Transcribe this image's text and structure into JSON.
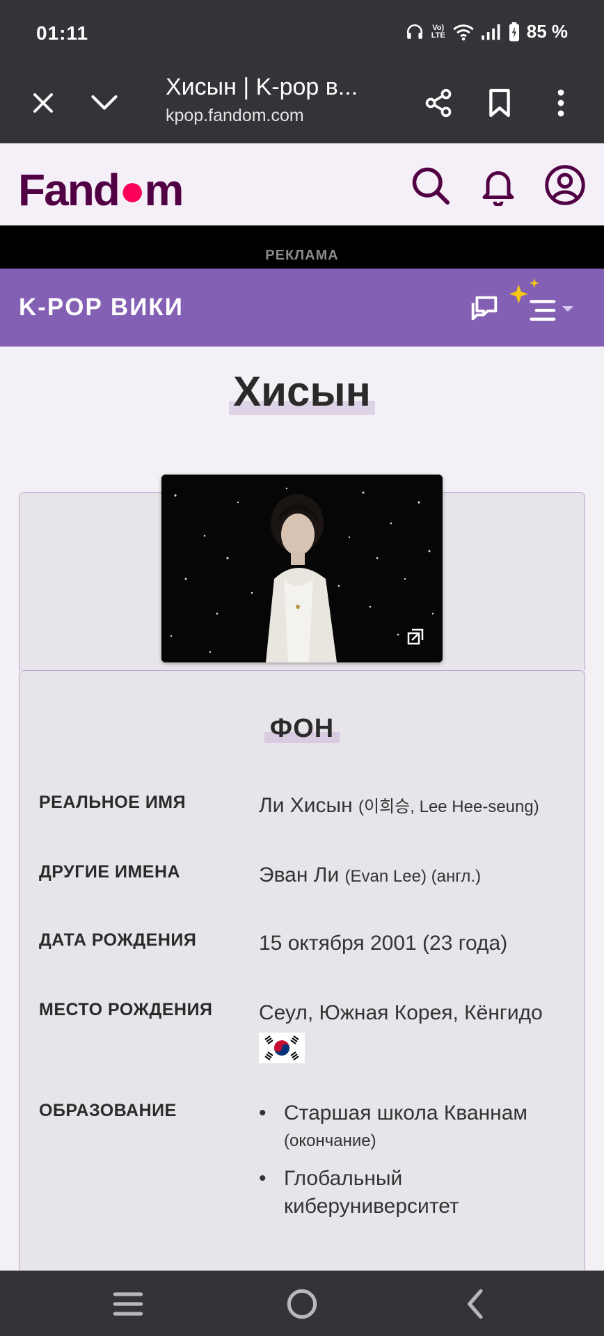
{
  "status": {
    "time": "01:11",
    "battery": "85 %",
    "volte": "Vo) LTE"
  },
  "browser": {
    "title": "Хисын | K-pop в...",
    "url": "kpop.fandom.com"
  },
  "fandom": {
    "logo_pre": "Fan",
    "logo_flame": "d",
    "logo_post": "m"
  },
  "ad": {
    "label": "РЕКЛАМА"
  },
  "wiki": {
    "name": "K-POP ВИКИ"
  },
  "article": {
    "title": "Хисын"
  },
  "infobox": {
    "section_title": "ФОН",
    "rows": [
      {
        "label": "РЕАЛЬНОЕ ИМЯ",
        "value": "Ли Хисын",
        "value_small": "(이희승, Lee Hee-seung)"
      },
      {
        "label": "ДРУГИЕ ИМЕНА",
        "value": "Эван Ли",
        "value_small": "(Evan Lee) (англ.)"
      },
      {
        "label": "ДАТА РОЖДЕНИЯ",
        "value": "15 октября 2001 (23 года)"
      },
      {
        "label": "МЕСТО РОЖДЕНИЯ",
        "value": "Сеул, Южная Корея, Кёнгидо"
      },
      {
        "label": "ОБРАЗОВАНИЕ",
        "items": [
          {
            "text": "Старшая школа Кваннам",
            "note": "(окончание)"
          },
          {
            "line1": "Глобальный",
            "line2": "киберуниверситет"
          }
        ]
      }
    ]
  },
  "colors": {
    "wiki_bar": "#8460b4",
    "fandom_brand": "#520044",
    "flame": "#fa005a"
  }
}
